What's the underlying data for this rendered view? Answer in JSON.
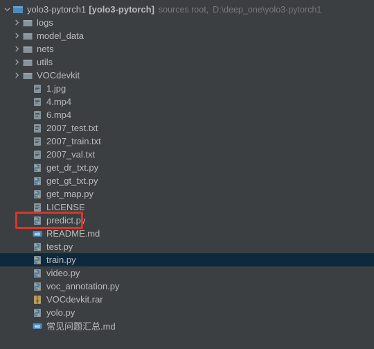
{
  "root": {
    "name": "yolo3-pytorch1",
    "module": "[yolo3-pytorch]",
    "tag": "sources root,",
    "path": "D:\\deep_one\\yolo3-pytorch1"
  },
  "folders": [
    {
      "label": "logs"
    },
    {
      "label": "model_data"
    },
    {
      "label": "nets"
    },
    {
      "label": "utils"
    },
    {
      "label": "VOCdevkit"
    }
  ],
  "files": [
    {
      "label": "1.jpg",
      "type": "txt"
    },
    {
      "label": "4.mp4",
      "type": "txt"
    },
    {
      "label": "6.mp4",
      "type": "txt"
    },
    {
      "label": "2007_test.txt",
      "type": "txt"
    },
    {
      "label": "2007_train.txt",
      "type": "txt"
    },
    {
      "label": "2007_val.txt",
      "type": "txt"
    },
    {
      "label": "get_dr_txt.py",
      "type": "py"
    },
    {
      "label": "get_gt_txt.py",
      "type": "py"
    },
    {
      "label": "get_map.py",
      "type": "py"
    },
    {
      "label": "LICENSE",
      "type": "txt"
    },
    {
      "label": "predict.py",
      "type": "py",
      "highlighted": true
    },
    {
      "label": "README.md",
      "type": "md"
    },
    {
      "label": "test.py",
      "type": "py"
    },
    {
      "label": "train.py",
      "type": "py",
      "selected": true
    },
    {
      "label": "video.py",
      "type": "py"
    },
    {
      "label": "voc_annotation.py",
      "type": "py"
    },
    {
      "label": "VOCdevkit.rar",
      "type": "rar"
    },
    {
      "label": "yolo.py",
      "type": "py"
    },
    {
      "label": "常见问题汇总.md",
      "type": "md"
    }
  ]
}
